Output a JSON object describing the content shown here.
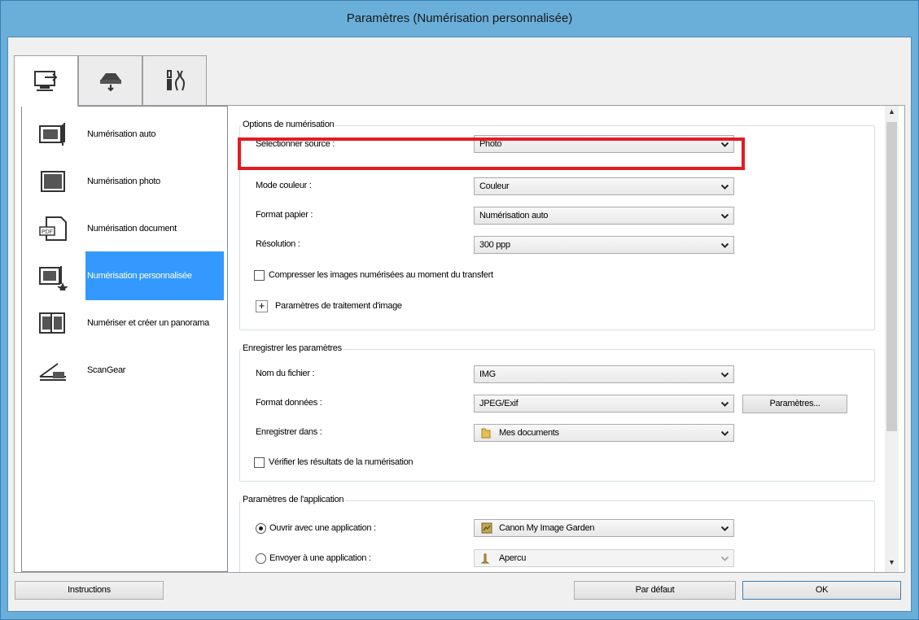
{
  "window": {
    "title": "Paramètres (Numérisation personnalisée)"
  },
  "tabs": [
    {
      "icon": "scan-from-computer-icon",
      "active": true
    },
    {
      "icon": "scan-from-operation-panel-icon",
      "active": false
    },
    {
      "icon": "general-settings-icon",
      "active": false
    }
  ],
  "sidebar": {
    "items": [
      {
        "label": "Numérisation auto",
        "icon": "auto-scan-icon"
      },
      {
        "label": "Numérisation photo",
        "icon": "photo-scan-icon"
      },
      {
        "label": "Numérisation document",
        "icon": "document-scan-icon"
      },
      {
        "label": "Numérisation personnalisée",
        "icon": "custom-scan-icon",
        "selected": true
      },
      {
        "label": "Numériser et créer un panorama",
        "icon": "stitch-icon"
      },
      {
        "label": "ScanGear",
        "icon": "scangear-icon"
      }
    ]
  },
  "scan_options": {
    "title": "Options de numérisation",
    "source_label": "Sélectionner source :",
    "source_value": "Photo",
    "color_label": "Mode couleur :",
    "color_value": "Couleur",
    "paper_label": "Format papier :",
    "paper_value": "Numérisation auto",
    "res_label": "Résolution :",
    "res_value": "300 ppp",
    "compress_label": "Compresser les images numérisées au moment du transfert",
    "compress_checked": false,
    "image_proc_label": "Paramètres de traitement d'image",
    "plus_glyph": "+"
  },
  "save_settings": {
    "title": "Enregistrer les paramètres",
    "filename_label": "Nom du fichier :",
    "filename_value": "IMG",
    "format_label": "Format données :",
    "format_value": "JPEG/Exif",
    "params_button": "Paramètres...",
    "savein_label": "Enregistrer dans :",
    "savein_value": "Mes documents",
    "verify_label": "Vérifier les résultats de la numérisation",
    "verify_checked": false
  },
  "app_settings": {
    "title": "Paramètres de l'application",
    "open_label": "Ouvrir avec une application :",
    "open_value": "Canon My Image Garden",
    "open_selected": true,
    "send_label": "Envoyer à une application :",
    "send_value": "Apercu"
  },
  "footer": {
    "instructions": "Instructions",
    "default": "Par défaut",
    "ok": "OK"
  },
  "colors": {
    "highlight": "#e31b23",
    "selection": "#3399ff",
    "frame": "#6aaeda"
  }
}
